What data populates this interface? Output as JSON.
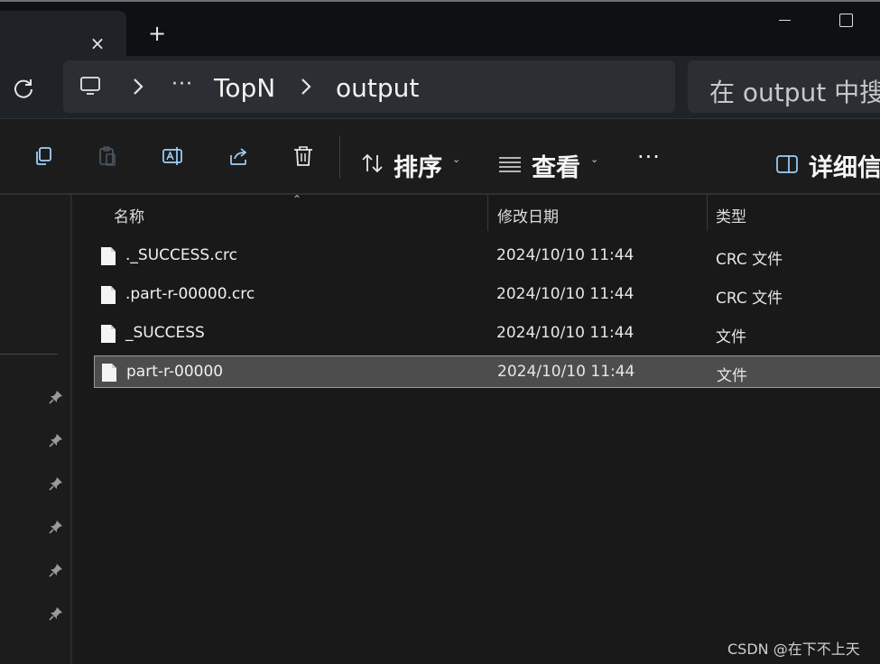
{
  "titlebar": {
    "close_tab_glyph": "×",
    "new_tab_glyph": "+"
  },
  "address": {
    "more_glyph": "···",
    "crumbs": [
      "TopN",
      "output"
    ]
  },
  "search": {
    "placeholder": "在 output 中搜"
  },
  "toolbar": {
    "sort_label": "排序",
    "view_label": "查看",
    "more_glyph": "···",
    "details_label": "详细信"
  },
  "columns": {
    "name": "名称",
    "date": "修改日期",
    "type": "类型"
  },
  "files": [
    {
      "name": "._SUCCESS.crc",
      "date": "2024/10/10 11:44",
      "type": "CRC 文件",
      "selected": false
    },
    {
      "name": ".part-r-00000.crc",
      "date": "2024/10/10 11:44",
      "type": "CRC 文件",
      "selected": false
    },
    {
      "name": "_SUCCESS",
      "date": "2024/10/10 11:44",
      "type": "文件",
      "selected": false
    },
    {
      "name": "part-r-00000",
      "date": "2024/10/10 11:44",
      "type": "文件",
      "selected": true
    }
  ],
  "watermark": "CSDN @在下不上天",
  "colors": {
    "accent_blue": "#9fd0ff",
    "background": "#191919",
    "selection": "#4d4d4d"
  }
}
